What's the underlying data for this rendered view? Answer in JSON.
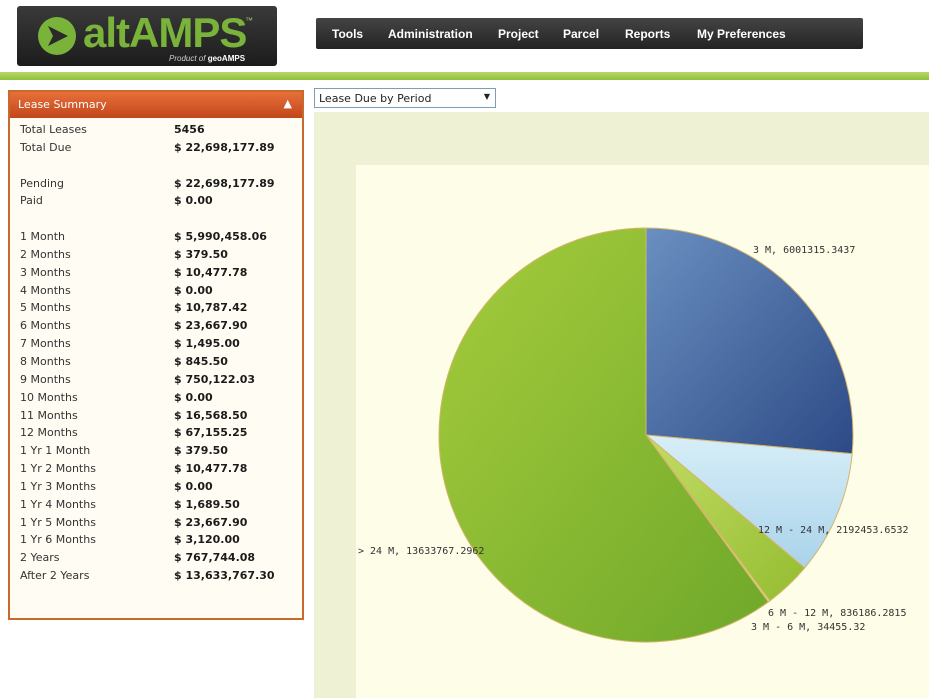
{
  "header": {
    "logo_text": "altAMPS",
    "logo_tm": "™",
    "logo_sub_prefix": "Product of",
    "logo_sub_brand": "geoAMPS",
    "nav": [
      {
        "label": "Tools"
      },
      {
        "label": "Administration"
      },
      {
        "label": "Project"
      },
      {
        "label": "Parcel"
      },
      {
        "label": "Reports"
      },
      {
        "label": "My Preferences"
      }
    ]
  },
  "lease_summary": {
    "title": "Lease Summary",
    "rows": [
      {
        "label": "Total Leases",
        "value": "5456"
      },
      {
        "label": "Total Due",
        "value": "$ 22,698,177.89"
      },
      {
        "label": "",
        "value": ""
      },
      {
        "label": "Pending",
        "value": "$ 22,698,177.89"
      },
      {
        "label": "Paid",
        "value": "$ 0.00"
      },
      {
        "label": "",
        "value": ""
      },
      {
        "label": "1 Month",
        "value": "$ 5,990,458.06"
      },
      {
        "label": "2 Months",
        "value": "$ 379.50"
      },
      {
        "label": "3 Months",
        "value": "$ 10,477.78"
      },
      {
        "label": "4 Months",
        "value": "$ 0.00"
      },
      {
        "label": "5 Months",
        "value": "$ 10,787.42"
      },
      {
        "label": "6 Months",
        "value": "$ 23,667.90"
      },
      {
        "label": "7 Months",
        "value": "$ 1,495.00"
      },
      {
        "label": "8 Months",
        "value": "$ 845.50"
      },
      {
        "label": "9 Months",
        "value": "$ 750,122.03"
      },
      {
        "label": "10 Months",
        "value": "$ 0.00"
      },
      {
        "label": "11 Months",
        "value": "$ 16,568.50"
      },
      {
        "label": "12 Months",
        "value": "$ 67,155.25"
      },
      {
        "label": "1 Yr 1 Month",
        "value": "$ 379.50"
      },
      {
        "label": "1 Yr 2 Months",
        "value": "$ 10,477.78"
      },
      {
        "label": "1 Yr 3 Months",
        "value": "$ 0.00"
      },
      {
        "label": "1 Yr 4 Months",
        "value": "$ 1,689.50"
      },
      {
        "label": "1 Yr 5 Months",
        "value": "$ 23,667.90"
      },
      {
        "label": "1 Yr 6 Months",
        "value": "$ 3,120.00"
      },
      {
        "label": "2 Years",
        "value": "$ 767,744.08"
      },
      {
        "label": "After 2 Years",
        "value": "$ 13,633,767.30"
      }
    ]
  },
  "report_select": {
    "selected": "Lease Due by Period"
  },
  "chart_data": {
    "type": "pie",
    "slices": [
      {
        "name": "3 M",
        "value": 6001315.3437,
        "label": "3 M, 6001315.3437",
        "color": "#4a6ea6"
      },
      {
        "name": "12 M - 24 M",
        "value": 2192453.6532,
        "label": "12 M - 24 M, 2192453.6532",
        "color": "#bfe2f2"
      },
      {
        "name": "6 M - 12 M",
        "value": 836186.2815,
        "label": "6 M - 12 M, 836186.2815",
        "color": "#9cc43c"
      },
      {
        "name": "3 M - 6 M",
        "value": 34455.32,
        "label": "3 M - 6 M, 34455.32",
        "color": "#d8e98a"
      },
      {
        "name": "> 24 M",
        "value": 13633767.2962,
        "label": "> 24 M, 13633767.2962",
        "color": "#8cbf32"
      }
    ]
  }
}
